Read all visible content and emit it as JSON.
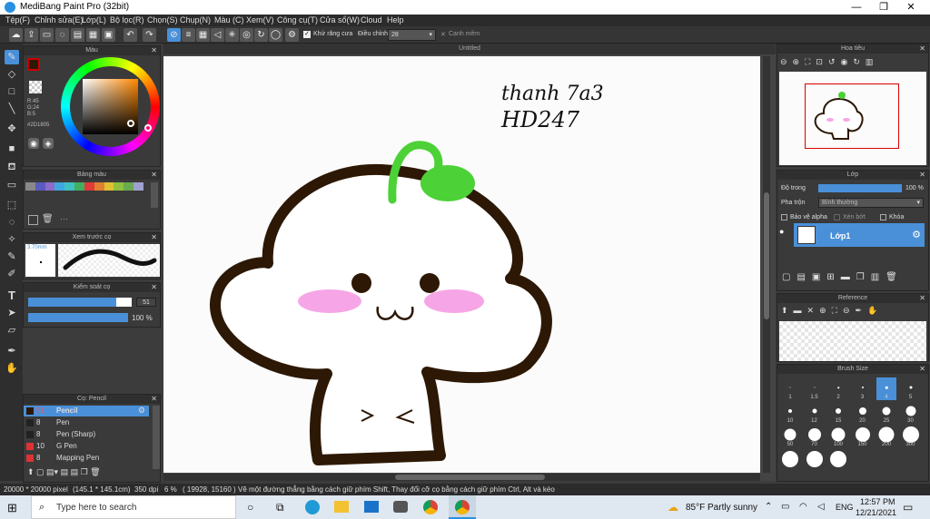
{
  "window": {
    "title": "MediBang Paint Pro (32bit)",
    "min": "—",
    "max": "❐",
    "close": "✕"
  },
  "menu": [
    "Tệp(F)",
    "Chỉnh sửa(E)",
    "Lớp(L)",
    "Bộ lọc(R)",
    "Chọn(S)",
    "Chụp(N)",
    "Màu (C)",
    "Xem(V)",
    "Công cụ(T)",
    "Cửa sổ(W)",
    "Cloud",
    "Help"
  ],
  "toolbar": {
    "antialias_label": "Khử răng cưa",
    "correction_label": "Điều chỉnh",
    "correction_value": "28",
    "snap_label": "Cạnh mềm"
  },
  "panels": {
    "color": "Màu",
    "palette": "Bảng màu",
    "brush_preview": "Xem trước cọ",
    "brush_control": "Kiểm soát cọ",
    "brush_list": "Cọ: Pencil",
    "navigator": "Hoa tiêu",
    "layer": "Lớp",
    "reference": "Reference",
    "brush_size": "Brush Size"
  },
  "color": {
    "r": "R:45",
    "g": "G:24",
    "b": "B:5",
    "hex": "#2D1805",
    "fg": "#2D1805"
  },
  "brush_preview": {
    "size": "3.70mm"
  },
  "brush_control": {
    "size": "51",
    "opacity": "100 %",
    "size_fraction": 0.85,
    "opacity_fraction": 1.0
  },
  "brushes": [
    {
      "num": "51",
      "name": "Pencil",
      "sel": true,
      "color": "#2D1805"
    },
    {
      "num": "8",
      "name": "Pen",
      "color": "#222"
    },
    {
      "num": "8",
      "name": "Pen (Sharp)",
      "color": "#222"
    },
    {
      "num": "10",
      "name": "G Pen",
      "color": "#d33"
    },
    {
      "num": "8",
      "name": "Mapping Pen",
      "color": "#d33"
    }
  ],
  "canvas": {
    "tab": "Untitled",
    "note_line1": "thanh 7a3",
    "note_line2": "HD247"
  },
  "layer": {
    "opacity_label": "Độ trong",
    "opacity_value": "100 %",
    "blend_label": "Pha trộn",
    "blend_value": "Bình thường",
    "protect_alpha": "Bảo vệ alpha",
    "clipping": "Xén bớt",
    "lock": "Khóa",
    "layer_name": "Lớp1"
  },
  "brush_sizes": [
    "1",
    "1.5",
    "2",
    "3",
    "4",
    "5",
    "10",
    "12",
    "15",
    "20",
    "25",
    "30",
    "50",
    "70",
    "100",
    "150",
    "200",
    "300"
  ],
  "status": {
    "size": "20000 * 20000 pixel",
    "mm": "(145.1 * 145.1cm)",
    "dpi": "350 dpi",
    "zoom": "6 %",
    "coords": "( 19928, 15160 )",
    "hint": "Vẽ một đường thẳng bằng cách giữ phím Shift, Thay đổi cỡ cọ bằng cách giữ phím Ctrl, Alt và kéo"
  },
  "taskbar": {
    "search": "Type here to search",
    "weather": "85°F  Partly sunny",
    "lang": "ENG",
    "time": "12:57 PM",
    "date": "12/21/2021"
  }
}
